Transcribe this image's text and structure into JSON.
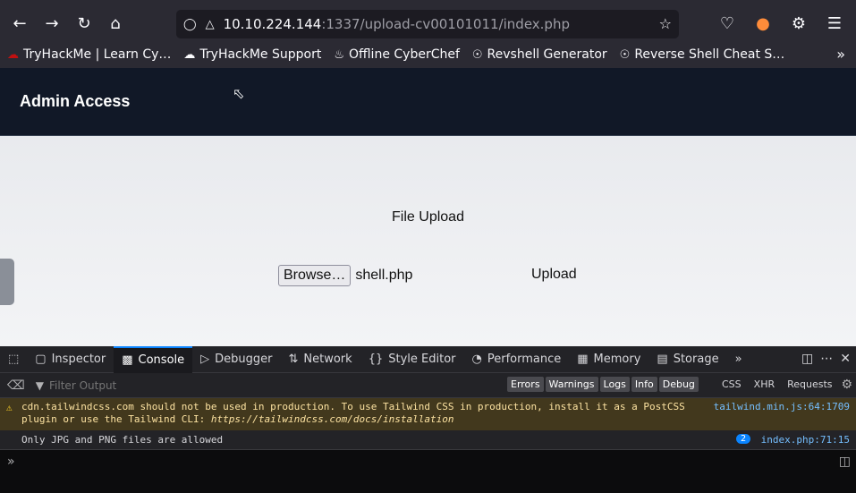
{
  "browser": {
    "url_host": "10.10.224.144",
    "url_rest": ":1337/upload-cv00101011/index.php",
    "bookmarks": [
      {
        "label": "TryHackMe | Learn Cy…",
        "icon": "thm-icon"
      },
      {
        "label": "TryHackMe Support",
        "icon": "cloud-icon"
      },
      {
        "label": "Offline CyberChef",
        "icon": "chef-icon"
      },
      {
        "label": "Revshell Generator",
        "icon": "globe-icon"
      },
      {
        "label": "Reverse Shell Cheat S…",
        "icon": "globe-icon"
      }
    ]
  },
  "page": {
    "header_title": "Admin Access",
    "upload_title": "File Upload",
    "browse_label": "Browse…",
    "file_name": "shell.php",
    "upload_label": "Upload"
  },
  "devtools": {
    "tabs": [
      "Inspector",
      "Console",
      "Debugger",
      "Network",
      "Style Editor",
      "Performance",
      "Memory",
      "Storage"
    ],
    "active_tab": "Console",
    "filter_placeholder": "Filter Output",
    "levels": [
      "Errors",
      "Warnings",
      "Logs",
      "Info",
      "Debug"
    ],
    "net_filters": [
      "CSS",
      "XHR",
      "Requests"
    ],
    "warning_line1": "cdn.tailwindcss.com should not be used in production. To use Tailwind CSS in production, install it as a PostCSS",
    "warning_line2": "plugin or use the Tailwind CLI: ",
    "warning_link": "https://tailwindcss.com/docs/installation",
    "warning_src": "tailwind.min.js:64:1709",
    "log_text": "Only JPG and PNG files are allowed",
    "log_count": "2",
    "log_src": "index.php:71:15"
  }
}
